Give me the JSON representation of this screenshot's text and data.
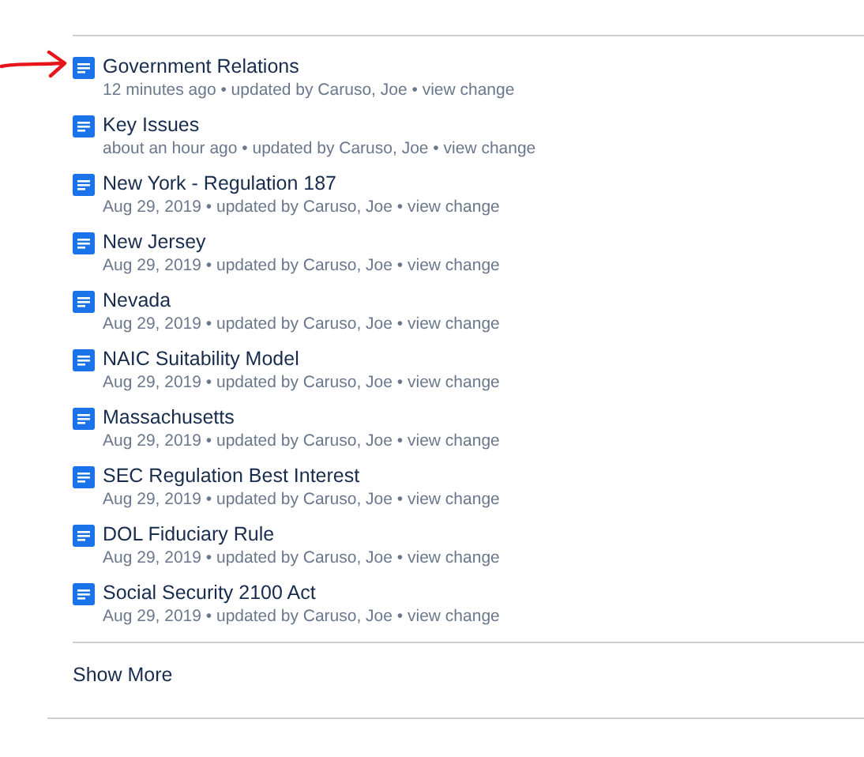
{
  "pages": [
    {
      "title": "Government Relations",
      "meta": "12 minutes ago • updated by Caruso, Joe •",
      "link": "view change"
    },
    {
      "title": "Key Issues",
      "meta": "about an hour ago • updated by Caruso, Joe •",
      "link": "view change"
    },
    {
      "title": "New York - Regulation 187",
      "meta": "Aug 29, 2019 • updated by Caruso, Joe •",
      "link": "view change"
    },
    {
      "title": "New Jersey",
      "meta": "Aug 29, 2019 • updated by Caruso, Joe •",
      "link": "view change"
    },
    {
      "title": "Nevada",
      "meta": "Aug 29, 2019 • updated by Caruso, Joe •",
      "link": "view change"
    },
    {
      "title": "NAIC Suitability Model",
      "meta": "Aug 29, 2019 • updated by Caruso, Joe •",
      "link": "view change"
    },
    {
      "title": "Massachusetts",
      "meta": "Aug 29, 2019 • updated by Caruso, Joe •",
      "link": "view change"
    },
    {
      "title": "SEC Regulation Best Interest",
      "meta": "Aug 29, 2019 • updated by Caruso, Joe •",
      "link": "view change"
    },
    {
      "title": "DOL Fiduciary Rule",
      "meta": "Aug 29, 2019 • updated by Caruso, Joe •",
      "link": "view change"
    },
    {
      "title": "Social Security 2100 Act",
      "meta": "Aug 29, 2019 • updated by Caruso, Joe •",
      "link": "view change"
    }
  ],
  "show_more": "Show More"
}
